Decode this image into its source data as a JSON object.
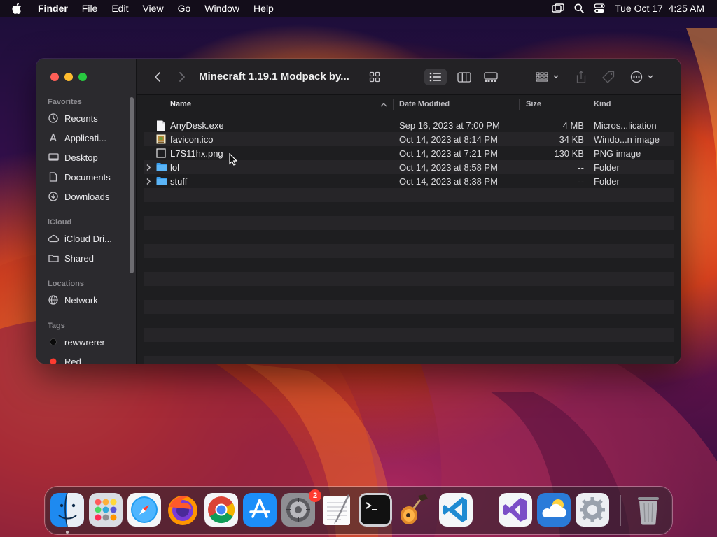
{
  "menubar": {
    "app_name": "Finder",
    "menus": [
      "File",
      "Edit",
      "View",
      "Go",
      "Window",
      "Help"
    ],
    "datetime": "Tue Oct 17  4:25 AM"
  },
  "window": {
    "title": "Minecraft 1.19.1 Modpack by...",
    "sidebar": {
      "favorites_header": "Favorites",
      "favorites": [
        {
          "label": "Recents",
          "icon": "clock-icon"
        },
        {
          "label": "Applicati...",
          "icon": "applications-icon"
        },
        {
          "label": "Desktop",
          "icon": "desktop-icon"
        },
        {
          "label": "Documents",
          "icon": "document-icon"
        },
        {
          "label": "Downloads",
          "icon": "download-icon"
        }
      ],
      "icloud_header": "iCloud",
      "icloud": [
        {
          "label": "iCloud Dri...",
          "icon": "cloud-icon"
        },
        {
          "label": "Shared",
          "icon": "shared-folder-icon"
        }
      ],
      "locations_header": "Locations",
      "locations": [
        {
          "label": "Network",
          "icon": "globe-icon"
        }
      ],
      "tags_header": "Tags",
      "tags": [
        {
          "label": "rewwrerer",
          "color": "#000000"
        },
        {
          "label": "Red",
          "color": "#ff3b30"
        }
      ]
    },
    "columns": {
      "name": "Name",
      "date": "Date Modified",
      "size": "Size",
      "kind": "Kind"
    },
    "files": [
      {
        "name": "AnyDesk.exe",
        "date": "Sep 16, 2023 at 7:00 PM",
        "size": "4 MB",
        "kind": "Micros...lication",
        "icon": "file-icon"
      },
      {
        "name": "favicon.ico",
        "date": "Oct 14, 2023 at 8:14 PM",
        "size": "34 KB",
        "kind": "Windo...n image",
        "icon": "image-icon"
      },
      {
        "name": "L7S11hx.png",
        "date": "Oct 14, 2023 at 7:21 PM",
        "size": "130 KB",
        "kind": "PNG image",
        "icon": "png-icon"
      },
      {
        "name": "lol",
        "date": "Oct 14, 2023 at 8:58 PM",
        "size": "--",
        "kind": "Folder",
        "icon": "folder-icon"
      },
      {
        "name": "stuff",
        "date": "Oct 14, 2023 at 8:38 PM",
        "size": "--",
        "kind": "Folder",
        "icon": "folder-icon"
      }
    ]
  },
  "dock": {
    "apps": [
      "finder-icon",
      "launchpad-icon",
      "safari-icon",
      "firefox-icon",
      "chrome-icon",
      "app-store-icon",
      "system-preferences-icon",
      "textedit-icon",
      "terminal-icon",
      "garageband-icon",
      "vscode-icon",
      "visual-studio-icon",
      "weather-icon",
      "settings-gear-icon",
      "trash-icon"
    ],
    "badge_count": "2"
  },
  "colors": {
    "accent_folder": "#3aa0f0",
    "window_bg": "#1e1e20",
    "sidebar_bg": "#2b2a2e"
  }
}
